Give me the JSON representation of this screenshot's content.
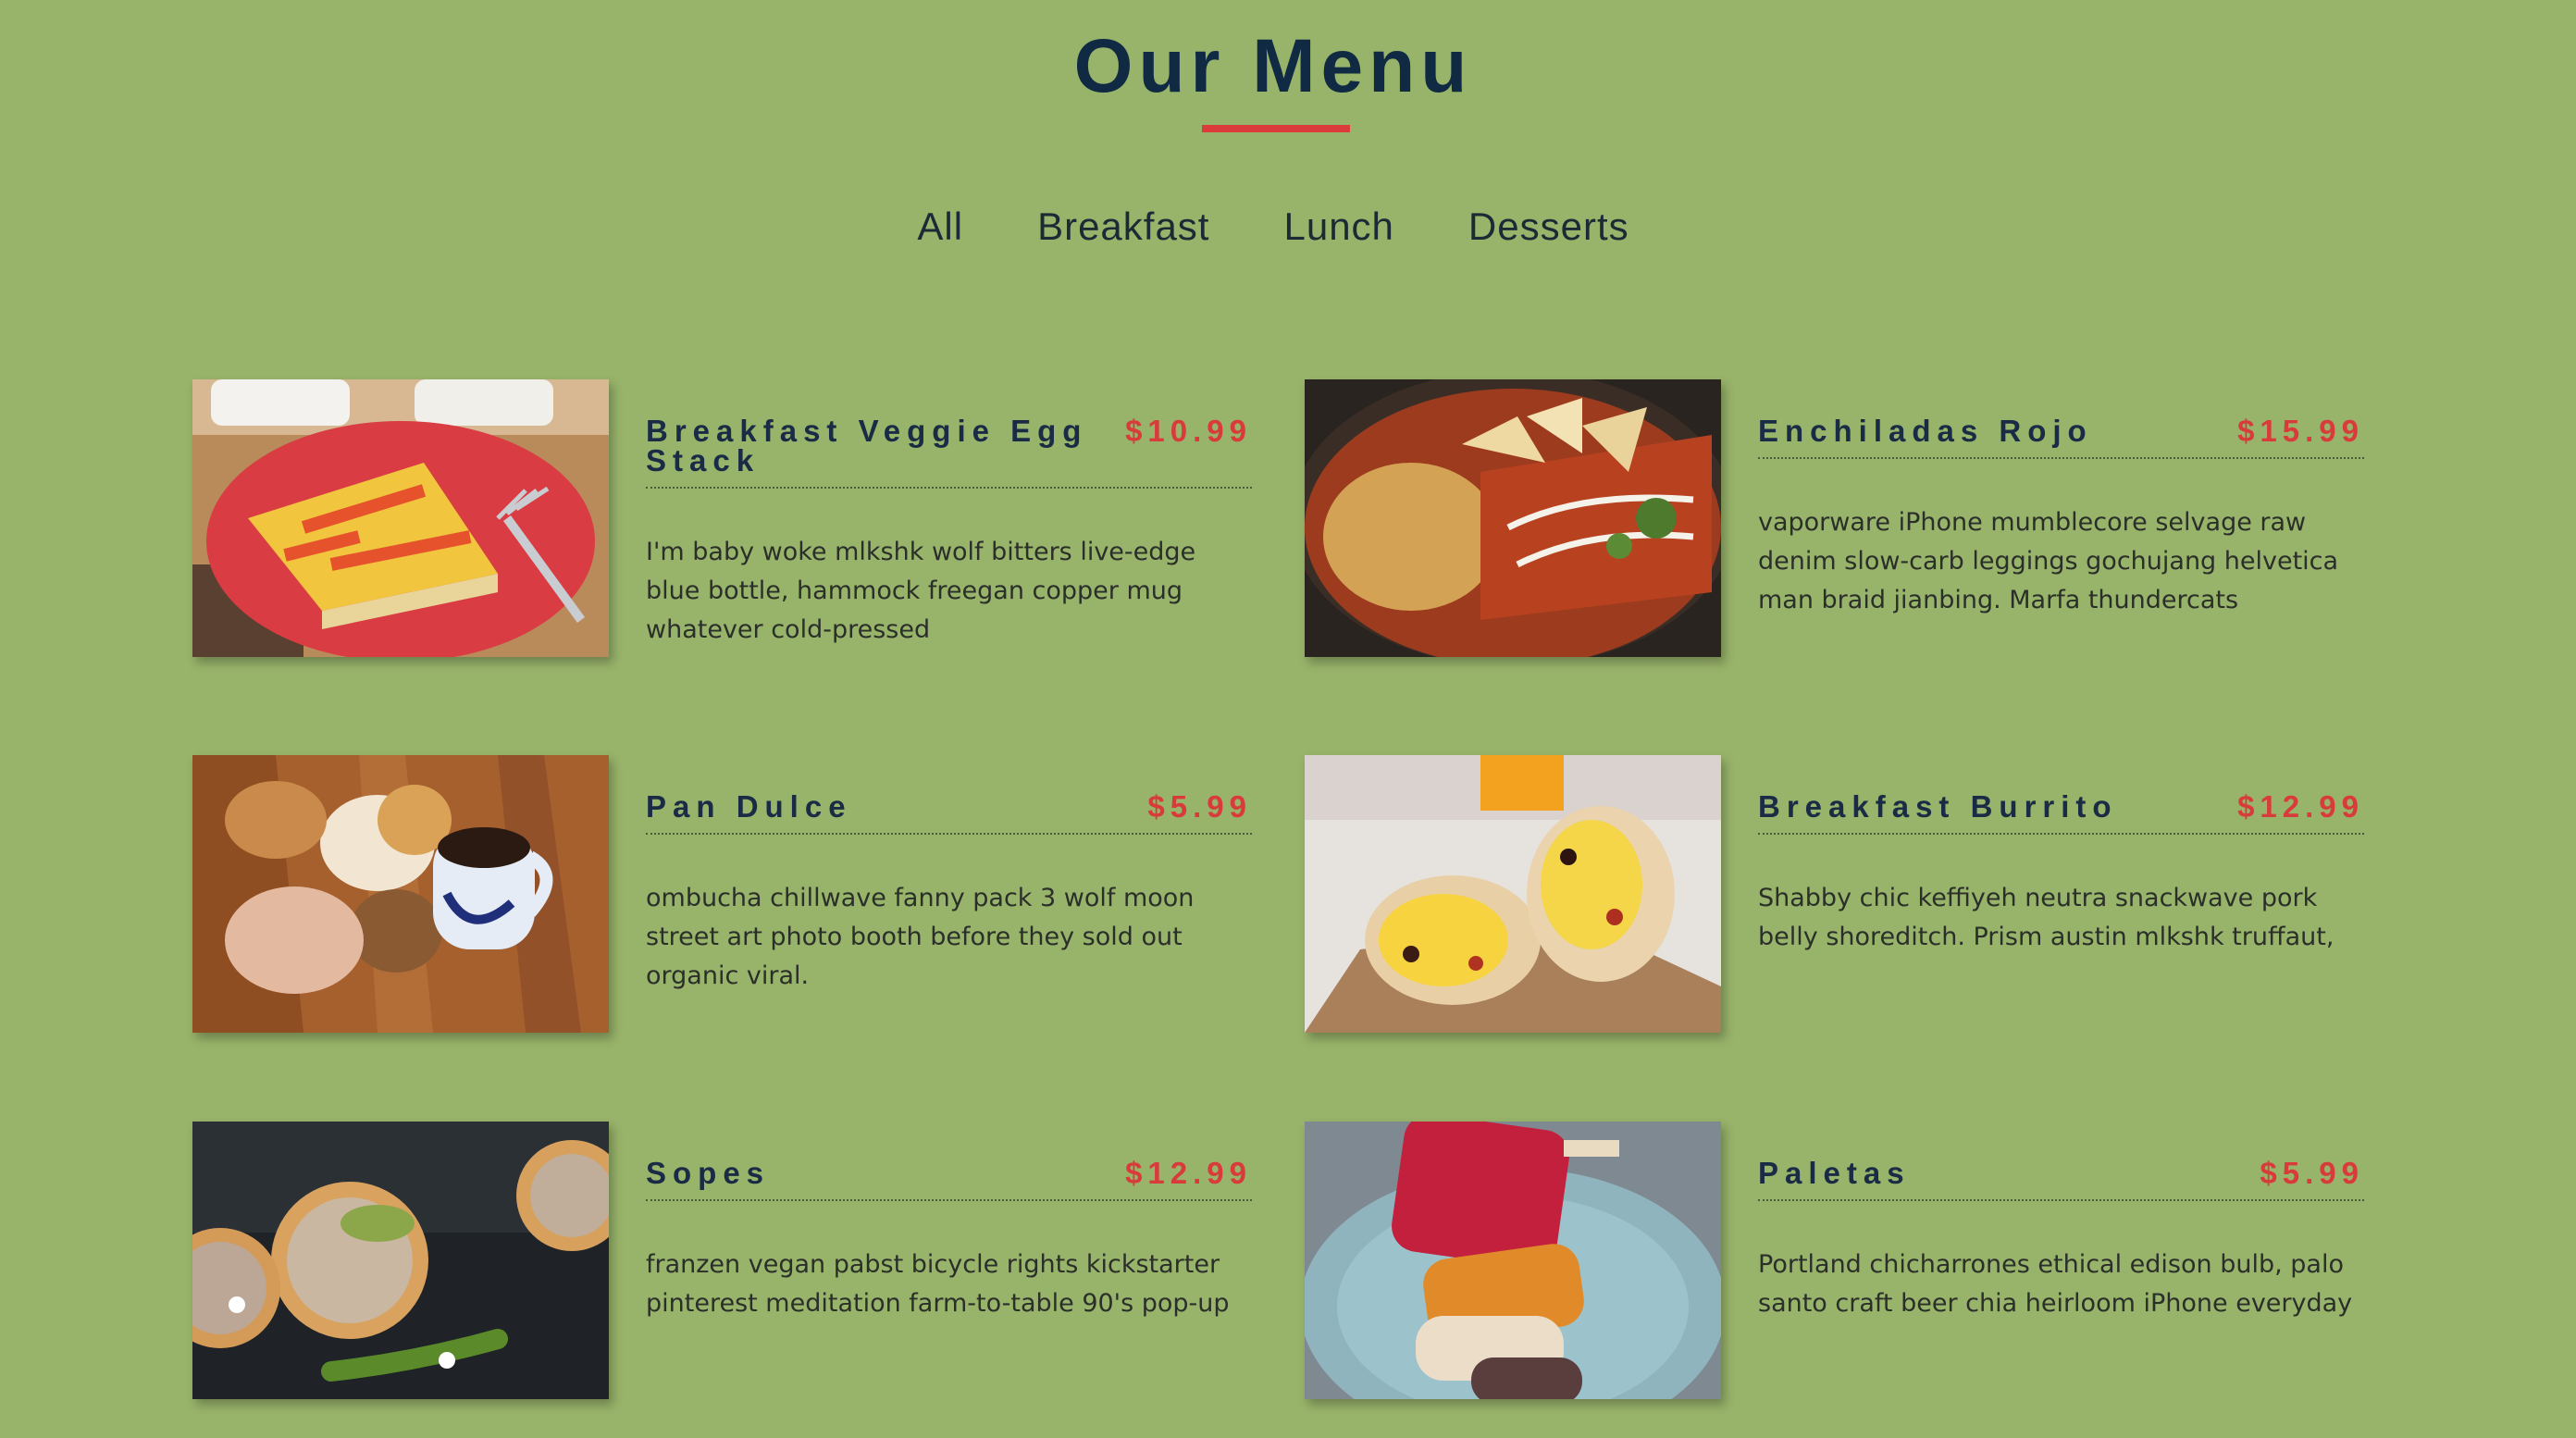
{
  "page": {
    "title": "Our Menu",
    "accent_color": "#dc3b3b",
    "background_color": "#98b36a"
  },
  "tabs": [
    {
      "label": "All"
    },
    {
      "label": "Breakfast"
    },
    {
      "label": "Lunch"
    },
    {
      "label": "Desserts"
    }
  ],
  "items": [
    {
      "name": "Breakfast Veggie Egg Stack",
      "price": "$10.99",
      "description": "I'm baby woke mlkshk wolf bitters live-edge blue bottle, hammock freegan copper mug whatever cold-pressed",
      "photo": "breakfast-veggie-egg-stack-photo"
    },
    {
      "name": "Enchiladas Rojo",
      "price": "$15.99",
      "description": "vaporware iPhone mumblecore selvage raw denim slow-carb leggings gochujang helvetica man braid jianbing. Marfa thundercats",
      "photo": "enchiladas-rojo-photo"
    },
    {
      "name": "Pan Dulce",
      "price": "$5.99",
      "description": "ombucha chillwave fanny pack 3 wolf moon street art photo booth before they sold out organic viral.",
      "photo": "pan-dulce-photo"
    },
    {
      "name": "Breakfast Burrito",
      "price": "$12.99",
      "description": "Shabby chic keffiyeh neutra snackwave pork belly shoreditch. Prism austin mlkshk truffaut,",
      "photo": "breakfast-burrito-photo"
    },
    {
      "name": "Sopes",
      "price": "$12.99",
      "description": "franzen vegan pabst bicycle rights kickstarter pinterest meditation farm-to-table 90's pop-up",
      "photo": "sopes-photo"
    },
    {
      "name": "Paletas",
      "price": "$5.99",
      "description": "Portland chicharrones ethical edison bulb, palo santo craft beer chia heirloom iPhone everyday",
      "photo": "paletas-photo"
    }
  ]
}
